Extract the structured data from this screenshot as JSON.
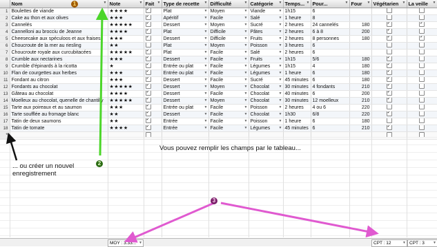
{
  "columns": [
    "Nom",
    "Note",
    "Fait",
    "Type de recette",
    "Difficulté",
    "Catégorie",
    "Temps...",
    "Pour...",
    "Four",
    "Végétarien",
    "La veille"
  ],
  "rows": [
    {
      "n": "1",
      "nom": "Boulettes de viande",
      "note": "★★★★",
      "fait": true,
      "type": "Plat",
      "diff": "Moyen",
      "cat": "Viande",
      "temps": "1h15",
      "pour": "6",
      "four": "",
      "veg": false,
      "veille": false
    },
    {
      "n": "2",
      "nom": "Cake au thon et aux olives",
      "note": "★★★",
      "fait": true,
      "type": "Apéritif",
      "diff": "Facile",
      "cat": "Salé",
      "temps": "1 heure",
      "pour": "8",
      "four": "",
      "veg": false,
      "veille": false
    },
    {
      "n": "3",
      "nom": "Cannelés",
      "note": "★★★★★",
      "fait": true,
      "type": "Dessert",
      "diff": "Moyen",
      "cat": "Sucré",
      "temps": "2 heures",
      "pour": "24 cannelés",
      "four": "180",
      "veg": true,
      "veille": true
    },
    {
      "n": "4",
      "nom": "Cannelloni au brocciu de Jeanne",
      "note": "★★★★",
      "fait": true,
      "type": "Plat",
      "diff": "Difficile",
      "cat": "Pâtes",
      "temps": "2 heures",
      "pour": "6 à 8",
      "four": "200",
      "veg": true,
      "veille": false
    },
    {
      "n": "5",
      "nom": "Cheesecake aux spéculoos et aux fraises",
      "note": "★★★",
      "fait": true,
      "type": "Dessert",
      "diff": "Difficile",
      "cat": "Fruits",
      "temps": "2 heures",
      "pour": "8 personnes",
      "four": "180",
      "veg": true,
      "veille": true
    },
    {
      "n": "6",
      "nom": "Choucroute de la mer au riesling",
      "note": "★★",
      "fait": false,
      "type": "Plat",
      "diff": "Moyen",
      "cat": "Poisson",
      "temps": "3 heures",
      "pour": "6",
      "four": "",
      "veg": false,
      "veille": false
    },
    {
      "n": "7",
      "nom": "Choucroute royale aux curcubitacées",
      "note": "★★★★★",
      "fait": true,
      "type": "Plat",
      "diff": "Facile",
      "cat": "Salé",
      "temps": "2 heures",
      "pour": "6",
      "four": "",
      "veg": false,
      "veille": false
    },
    {
      "n": "8",
      "nom": "Crumble aux nectarines",
      "note": "★★★",
      "fait": true,
      "type": "Dessert",
      "diff": "Facile",
      "cat": "Fruits",
      "temps": "1h15",
      "pour": "5/6",
      "four": "180",
      "veg": true,
      "veille": false
    },
    {
      "n": "9",
      "nom": "Crumble d'épinards à la ricotta",
      "note": "★",
      "fait": true,
      "type": "Entrée ou plat",
      "diff": "Facile",
      "cat": "Légumes",
      "temps": "1h15",
      "pour": "4",
      "four": "180",
      "veg": true,
      "veille": false
    },
    {
      "n": "10",
      "nom": "Flan de courgettes aux herbes",
      "note": "★★★",
      "fait": true,
      "type": "Entrée ou plat",
      "diff": "Facile",
      "cat": "Légumes",
      "temps": "1 heure",
      "pour": "6",
      "four": "180",
      "veg": true,
      "veille": false
    },
    {
      "n": "11",
      "nom": "Fondant au citron",
      "note": "★★★",
      "fait": true,
      "type": "Dessert",
      "diff": "Facile",
      "cat": "Sucré",
      "temps": "45 minutes",
      "pour": "6",
      "four": "180",
      "veg": true,
      "veille": false
    },
    {
      "n": "12",
      "nom": "Fondants au chocolat",
      "note": "★★★★★",
      "fait": true,
      "type": "Dessert",
      "diff": "Moyen",
      "cat": "Chocolat",
      "temps": "30 minutes",
      "pour": "4 fondants",
      "four": "210",
      "veg": true,
      "veille": false
    },
    {
      "n": "13",
      "nom": "Gâteau au chocolat",
      "note": "★★★★",
      "fait": true,
      "type": "Dessert",
      "diff": "Facile",
      "cat": "Chocolat",
      "temps": "40 minutes",
      "pour": "6",
      "four": "200",
      "veg": true,
      "veille": false
    },
    {
      "n": "14",
      "nom": "Moelleux au chocolat, quenelle de chantilly",
      "note": "★★★★★",
      "fait": true,
      "type": "Dessert",
      "diff": "Moyen",
      "cat": "Chocolat",
      "temps": "30 minutes",
      "pour": "12 moelleux",
      "four": "210",
      "veg": true,
      "veille": false
    },
    {
      "n": "15",
      "nom": "Tarte aux poireaux et au saumon",
      "note": "★★★",
      "fait": true,
      "type": "Entrée ou plat",
      "diff": "Facile",
      "cat": "Poisson",
      "temps": "2 heures",
      "pour": "4 ou 6",
      "four": "220",
      "veg": false,
      "veille": false
    },
    {
      "n": "16",
      "nom": "Tarte soufflée au fromage blanc",
      "note": "★★",
      "fait": true,
      "type": "Dessert",
      "diff": "Facile",
      "cat": "Chocolat",
      "temps": "1h30",
      "pour": "6/8",
      "four": "220",
      "veg": true,
      "veille": false
    },
    {
      "n": "17",
      "nom": "Tatin de deux saumons",
      "note": "★★",
      "fait": true,
      "type": "Entrée",
      "diff": "Facile",
      "cat": "Poisson",
      "temps": "1 heure",
      "pour": "6",
      "four": "180",
      "veg": false,
      "veille": false
    },
    {
      "n": "18",
      "nom": "Tatin de tomate",
      "note": "★★★★",
      "fait": true,
      "type": "Entrée",
      "diff": "Facile",
      "cat": "Légumes",
      "temps": "45 minutes",
      "pour": "6",
      "four": "210",
      "veg": true,
      "veille": false
    }
  ],
  "new_row_marker": "*",
  "annotations": {
    "badge1": "1",
    "badge2": "2",
    "badge3": "3",
    "fill_text": "Vous pouvez remplir les champs par le tableau...",
    "create_text_line1": "... ou créer un nouvel",
    "create_text_line2": "enregistrement"
  },
  "footer": {
    "moy": "MOY : 3.33...",
    "cpt_veg": "CPT : 12",
    "cpt_veille": "CPT : 3"
  },
  "colors": {
    "green_arrow": "#4cd62a",
    "pink_arrow": "#e05ad0",
    "black_arrow": "#111111"
  }
}
